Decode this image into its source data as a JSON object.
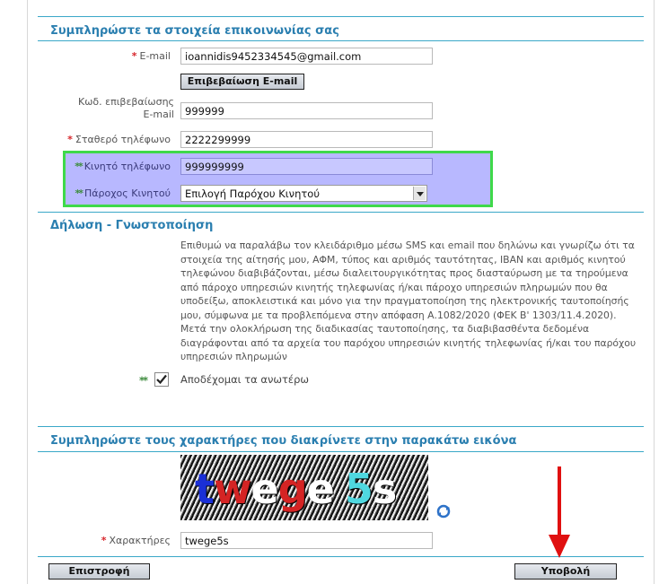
{
  "contact": {
    "title": "Συμπληρώστε τα στοιχεία επικοινωνίας σας",
    "email": {
      "label": "E-mail",
      "value": "ioannidis9452334545@gmail.com"
    },
    "confirm_email_button": "Επιβεβαίωση E-mail",
    "code": {
      "label_line1": "Κωδ. επιβεβαίωσης",
      "label_line2": "E-mail",
      "value": "999999"
    },
    "landline": {
      "label": "Σταθερό τηλέφωνο",
      "value": "2222299999"
    },
    "mobile": {
      "label": "Κινητό τηλέφωνο",
      "value": "999999999"
    },
    "provider": {
      "label": "Πάροχος Κινητού",
      "selected": "Επιλογή Παρόχου Κινητού"
    },
    "required_marker": "*",
    "double_marker": "**"
  },
  "declaration": {
    "title": "Δήλωση - Γνωστοποίηση",
    "text": "Επιθυμώ να παραλάβω τον κλειδάριθμο μέσω SMS και email που δηλώνω και γνωρίζω ότι τα στοιχεία της αίτησής μου, ΑΦΜ, τύπος και αριθμός ταυτότητας, IBAN και αριθμός κινητού τηλεφώνου διαβιβάζονται, μέσω διαλειτουργικότητας προς διασταύρωση με τα τηρούμενα από πάροχο υπηρεσιών κινητής τηλεφωνίας ή/και πάροχο υπηρεσιών πληρωμών που θα υποδείξω, αποκλειστικά και μόνο για την πραγματοποίηση της ηλεκτρονικής ταυτοποίησής μου, σύμφωνα με τα προβλεπόμενα στην απόφαση Α.1082/2020 (ΦΕΚ Β' 1303/11.4.2020). Μετά την ολοκλήρωση της διαδικασίας ταυτοποίησης, τα διαβιβασθέντα δεδομένα διαγράφονται από τα αρχεία του παρόχου υπηρεσιών κινητής τηλεφωνίας ή/και του παρόχου υπηρεσιών πληρωμών",
    "accept_label": "Αποδέχομαι τα ανωτέρω",
    "accepted": true
  },
  "captcha": {
    "title": "Συμπληρώστε τους χαρακτήρες που διακρίνετε στην παρακάτω εικόνα",
    "image_text": "twege5s",
    "label": "Χαρακτήρες",
    "value": "twege5s",
    "colors": [
      "#1a2fd6",
      "#d42424",
      "#ffffff",
      "#d42424",
      "#ffffff",
      "#4fd8e0",
      "#ffffff"
    ]
  },
  "footer": {
    "back_button": "Επιστροφή",
    "submit_button": "Υποβολή"
  },
  "colors": {
    "accent": "#2b7fb0",
    "required": "#d7262b",
    "highlight_border": "#3fd94a",
    "highlight_bg": "#b8b8ff",
    "annotation_arrow": "#e01010"
  }
}
